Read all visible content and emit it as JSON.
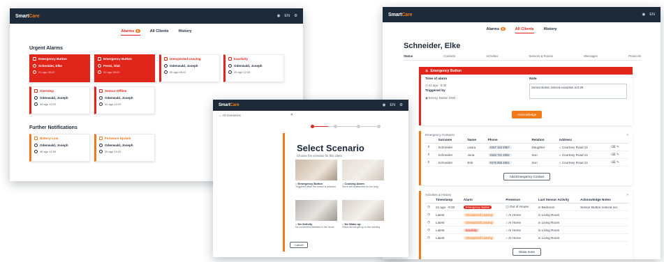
{
  "brand": {
    "name_prefix": "Smart",
    "name_suffix": "Care"
  },
  "header": {
    "lang": "EN"
  },
  "nav": {
    "alarms": "Alarms",
    "alarm_count": "9",
    "all_clients": "All Clients",
    "history": "History"
  },
  "dashboard": {
    "urgent_title": "Urgent Alarms",
    "further_title": "Further Notifications",
    "urgent": [
      {
        "type": "Emergency Button",
        "name": "Schneider, Elke",
        "time": "21 ago 08:22"
      },
      {
        "type": "Emergency Button",
        "name": "Perez, Olat",
        "time": "32 ago 08:22"
      },
      {
        "type": "Unexpected Leaving",
        "name": "Odenwald, Joseph",
        "time": "55 ago 08:22"
      },
      {
        "type": "Inactivity",
        "name": "Odenwald, Joseph",
        "time": "25 ago 12:33"
      },
      {
        "type": "Overstep",
        "name": "Odenwald, Joseph",
        "time": "34 ago 10:22"
      },
      {
        "type": "Sensor Offline",
        "name": "Odenwald, Joseph",
        "time": "44 ago 12:20"
      }
    ],
    "further": [
      {
        "type": "Battery Low",
        "name": "Odenwald, Joseph",
        "time": "48 ago 11:55"
      },
      {
        "type": "Firmware Update",
        "name": "Odenwald, Joseph",
        "time": "25 ago 10:20"
      }
    ]
  },
  "scenario": {
    "back": "All Scenarios",
    "title": "Select Scenario",
    "subtitle": "Choose the scenario for this client",
    "options": [
      {
        "label": "Emergency Button",
        "desc": "Triggered when the button is pressed"
      },
      {
        "label": "Cooking Alarm",
        "desc": "Stove left unattended for too long"
      },
      {
        "label": "No Activity",
        "desc": "No movement detected in the home"
      },
      {
        "label": "No Wake-up",
        "desc": "Client did not get up in the morning"
      }
    ],
    "cancel": "Cancel"
  },
  "client": {
    "name": "Schneider, Elke",
    "tabs": [
      "Status",
      "Contacts",
      "Activities",
      "Sensors & Rooms",
      "Messages",
      "Protocols"
    ],
    "alarm": {
      "title": "Emergency Button",
      "time_label": "Time of alarm",
      "time_value": "21 ago · 8:30",
      "triggered_label": "Triggered by",
      "triggered_value": "Emerg. Button 1093",
      "note_label": "Note",
      "note_value": "Sensor Button noticed exception at 8:29",
      "ack": "Acknowledge"
    },
    "contacts": {
      "title": "Emergency Contacts",
      "cols": [
        "Surname",
        "Name",
        "Phone",
        "Relation",
        "Address"
      ],
      "rows": [
        {
          "surname": "Schneider",
          "name": "Laura",
          "phone": "0157 123 4567",
          "relation": "Daughter",
          "address": "Courtney Road 21"
        },
        {
          "surname": "Schneider",
          "name": "Jona",
          "phone": "0163 721 4002",
          "relation": "Son",
          "address": "Courtney Road 21"
        },
        {
          "surname": "Schneider",
          "name": "Erik",
          "phone": "0176 855 4561",
          "relation": "Son",
          "address": "Courtney Road 21"
        }
      ],
      "add": "Add Emergency Contact"
    },
    "history": {
      "title": "Activities & History",
      "cols": [
        "Timestamp",
        "Alarm",
        "Presence",
        "Last Sensor Activity",
        "Acknowledge Notes"
      ],
      "rows": [
        {
          "ts": "21 ago · 8:30",
          "alarm": "Emergency Button",
          "alarm_kind": "red",
          "presence": "Out of House",
          "activity": "in Bedroom",
          "note": "Sensor Button noticed exc"
        },
        {
          "ts": "Latest",
          "alarm": "Unexpected Leaving",
          "alarm_kind": "orange",
          "presence": "At Home",
          "activity": "in Living Room",
          "note": ""
        },
        {
          "ts": "Latest",
          "alarm": "Unexpected Leaving",
          "alarm_kind": "orange",
          "presence": "At Home",
          "activity": "in Living Room",
          "note": ""
        },
        {
          "ts": "Latest",
          "alarm": "Inactivity",
          "alarm_kind": "red",
          "presence": "At Home",
          "activity": "in Living Room",
          "note": ""
        },
        {
          "ts": "Latest",
          "alarm": "Unexpected Leaving",
          "alarm_kind": "orange",
          "presence": "At Home",
          "activity": "in Living Room",
          "note": ""
        }
      ],
      "more": "Show more"
    }
  },
  "colors": {
    "dark": "#1d2a3a",
    "red": "#e0261b",
    "orange": "#f07a1a"
  }
}
